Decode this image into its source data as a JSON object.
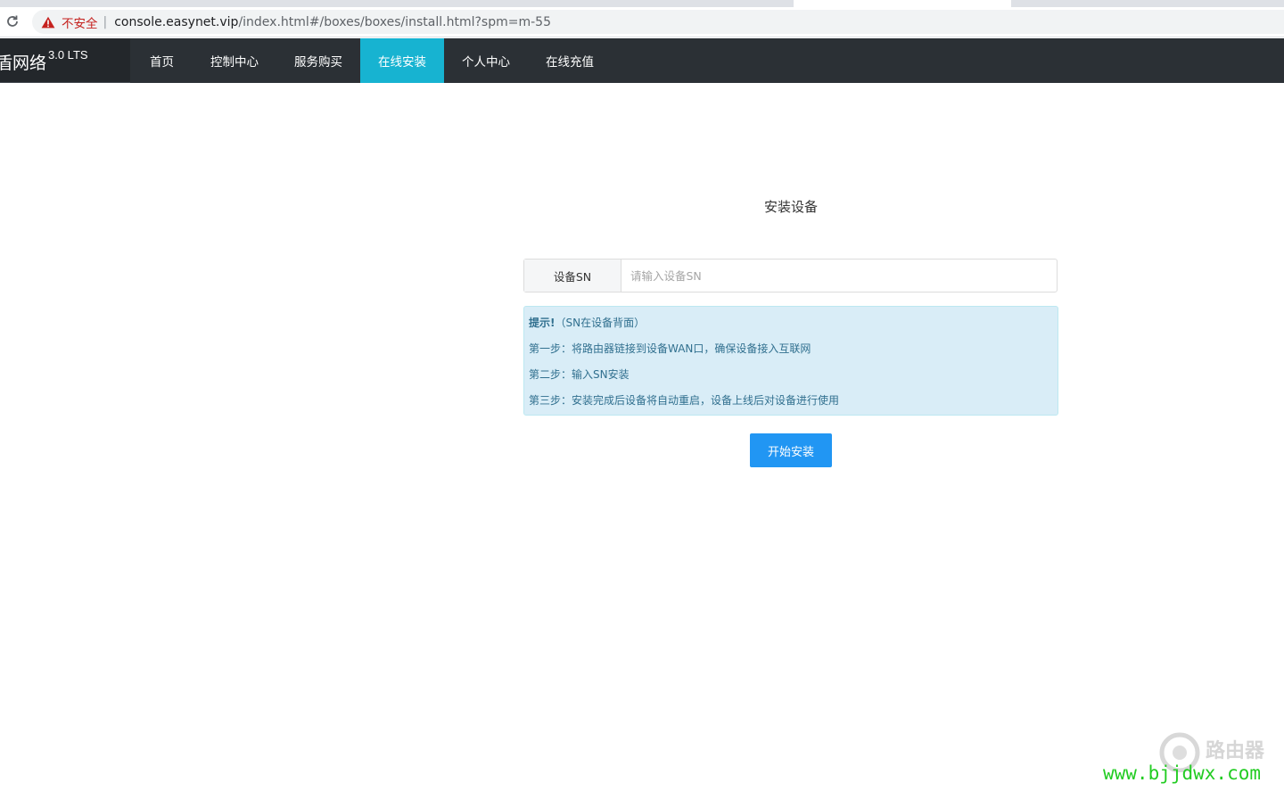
{
  "browser": {
    "security_label": "不安全",
    "url_host": "console.easynet.vip",
    "url_path": "/index.html#/boxes/boxes/install.html?spm=m-55"
  },
  "navbar": {
    "brand_name": "盾网络",
    "brand_version": "3.0 LTS",
    "items": [
      {
        "label": "首页"
      },
      {
        "label": "控制中心"
      },
      {
        "label": "服务购买"
      },
      {
        "label": "在线安装",
        "active": true
      },
      {
        "label": "个人中心"
      },
      {
        "label": "在线充值"
      }
    ],
    "active_color": "#17b3d1"
  },
  "main": {
    "title": "安装设备",
    "sn_field": {
      "label": "设备SN",
      "placeholder": "请输入设备SN",
      "value": ""
    },
    "tips": {
      "heading": "提示!",
      "note": "（SN在设备背面）",
      "steps": [
        "第一步：将路由器链接到设备WAN口，确保设备接入互联网",
        "第二步：输入SN安装",
        "第三步：安装完成后设备将自动重启，设备上线后对设备进行使用"
      ]
    },
    "submit_label": "开始安装",
    "submit_color": "#2196f3"
  },
  "watermark": {
    "name": "路由器",
    "url": "www.bjjdwx.com"
  }
}
